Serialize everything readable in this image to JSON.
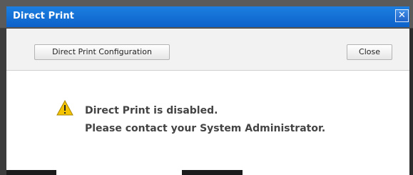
{
  "window": {
    "title": "Direct Print",
    "close_glyph": "✕"
  },
  "toolbar": {
    "config_button_label": "Direct Print Configuration",
    "close_button_label": "Close"
  },
  "message": {
    "icon": "warning-icon",
    "line1": "Direct Print is disabled.",
    "line2": "Please contact your System Administrator."
  },
  "colors": {
    "title_bar": "#1570d8",
    "warning_yellow": "#f5c400"
  }
}
